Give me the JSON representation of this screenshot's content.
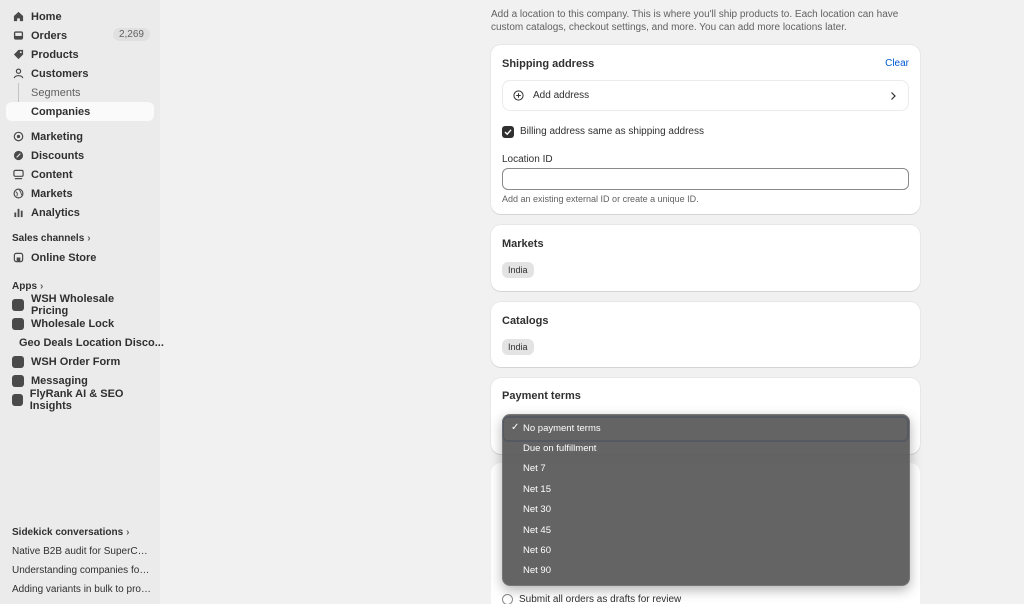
{
  "sidebar": {
    "home": "Home",
    "orders": "Orders",
    "orders_count": "2,269",
    "products": "Products",
    "customers": "Customers",
    "segments": "Segments",
    "companies": "Companies",
    "marketing": "Marketing",
    "discounts": "Discounts",
    "content": "Content",
    "markets": "Markets",
    "analytics": "Analytics",
    "sales_channels_label": "Sales channels",
    "online_store": "Online Store",
    "apps_label": "Apps",
    "apps": [
      "WSH Wholesale Pricing",
      "Wholesale Lock",
      "Geo Deals Location Disco...",
      "WSH Order Form",
      "Messaging",
      "FlyRank AI & SEO Insights"
    ],
    "sidekick_label": "Sidekick conversations",
    "sidekick": [
      "Native B2B audit for SuperCover",
      "Understanding companies for ...",
      "Adding variants in bulk to prod..."
    ]
  },
  "intro_text": "Add a location to this company. This is where you'll ship products to. Each location can have custom catalogs, checkout settings, and more. You can add more locations later.",
  "shipping": {
    "title": "Shipping address",
    "clear": "Clear",
    "add_address": "Add address",
    "billing_same": "Billing address same as shipping address",
    "location_id_label": "Location ID",
    "location_id_value": "",
    "location_id_help": "Add an existing external ID or create a unique ID."
  },
  "markets": {
    "title": "Markets",
    "tag": "India"
  },
  "catalogs": {
    "title": "Catalogs",
    "tag": "India"
  },
  "payment_terms": {
    "title": "Payment terms",
    "options": [
      "No payment terms",
      "Due on fulfillment",
      "Net 7",
      "Net 15",
      "Net 30",
      "Net 45",
      "Net 60",
      "Net 90"
    ],
    "selected": "No payment terms",
    "check_glyph": "✓"
  },
  "drafts_label": "Submit all orders as drafts for review"
}
